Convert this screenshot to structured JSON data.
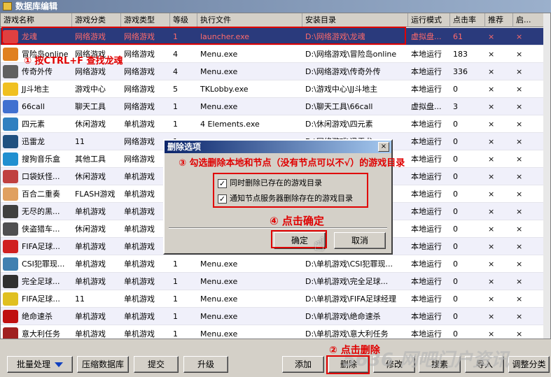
{
  "window": {
    "title": "数据库编辑"
  },
  "columns": [
    "游戏名称",
    "游戏分类",
    "游戏类型",
    "等级",
    "执行文件",
    "安装目录",
    "运行模式",
    "点击率",
    "推荐",
    "启..."
  ],
  "rows": [
    {
      "name": "龙魂",
      "category": "网络游戏",
      "type": "网络游戏",
      "level": "1",
      "exe": "launcher.exe",
      "dir": "D:\\网络游戏\\龙魂",
      "mode": "虚拟盘...",
      "clicks": "61",
      "rec": "×",
      "start": "×",
      "icon": "#e04040"
    },
    {
      "name": "冒险岛online",
      "category": "网络游戏",
      "type": "网络游戏",
      "level": "4",
      "exe": "Menu.exe",
      "dir": "D:\\网络游戏\\冒险岛online",
      "mode": "本地运行",
      "clicks": "183",
      "rec": "×",
      "start": "×",
      "icon": "#e08020"
    },
    {
      "name": "传奇外传",
      "category": "网络游戏",
      "type": "网络游戏",
      "level": "4",
      "exe": "Menu.exe",
      "dir": "D:\\网络游戏\\传奇外传",
      "mode": "本地运行",
      "clicks": "336",
      "rec": "×",
      "start": "×",
      "icon": "#606060"
    },
    {
      "name": "JJ斗地主",
      "category": "游戏中心",
      "type": "网络游戏",
      "level": "5",
      "exe": "TKLobby.exe",
      "dir": "D:\\游戏中心\\JJ斗地主",
      "mode": "本地运行",
      "clicks": "0",
      "rec": "×",
      "start": "×",
      "icon": "#f0c020"
    },
    {
      "name": "66call",
      "category": "聊天工具",
      "type": "网络游戏",
      "level": "1",
      "exe": "Menu.exe",
      "dir": "D:\\聊天工具\\66call",
      "mode": "虚拟盘...",
      "clicks": "3",
      "rec": "×",
      "start": "×",
      "icon": "#4070d0"
    },
    {
      "name": "四元素",
      "category": "休闲游戏",
      "type": "单机游戏",
      "level": "1",
      "exe": "4 Elements.exe",
      "dir": "D:\\休闲游戏\\四元素",
      "mode": "本地运行",
      "clicks": "0",
      "rec": "×",
      "start": "×",
      "icon": "#3080c0"
    },
    {
      "name": "迅雷龙",
      "category": "11",
      "type": "网络游戏",
      "level": "1",
      "exe": "",
      "dir": "D:\\网络游戏\\迅雷龙",
      "mode": "本地运行",
      "clicks": "0",
      "rec": "×",
      "start": "×",
      "icon": "#205080"
    },
    {
      "name": "搜狗音乐盒",
      "category": "其他工具",
      "type": "网络游戏",
      "level": "1",
      "exe": "",
      "dir": "",
      "mode": "本地运行",
      "clicks": "0",
      "rec": "×",
      "start": "×",
      "icon": "#2090d0"
    },
    {
      "name": "口袋妖怪...",
      "category": "休闲游戏",
      "type": "单机游戏",
      "level": "1",
      "exe": "",
      "dir": "",
      "mode": "本地运行",
      "clicks": "0",
      "rec": "×",
      "start": "×",
      "icon": "#c04040"
    },
    {
      "name": "百合二重奏",
      "category": "FLASH游戏",
      "type": "单机游戏",
      "level": "1",
      "exe": "",
      "dir": "",
      "mode": "本地运行",
      "clicks": "0",
      "rec": "×",
      "start": "×",
      "icon": "#e0a060"
    },
    {
      "name": "无尽的黑...",
      "category": "单机游戏",
      "type": "单机游戏",
      "level": "1",
      "exe": "",
      "dir": "",
      "mode": "本地运行",
      "clicks": "0",
      "rec": "×",
      "start": "×",
      "icon": "#404040"
    },
    {
      "name": "侠盗猎车...",
      "category": "休闲游戏",
      "type": "单机游戏",
      "level": "1",
      "exe": "",
      "dir": "",
      "mode": "本地运行",
      "clicks": "0",
      "rec": "×",
      "start": "×",
      "icon": "#505050"
    },
    {
      "name": "FIFA足球...",
      "category": "单机游戏",
      "type": "单机游戏",
      "level": "1",
      "exe": "",
      "dir": "",
      "mode": "本地运行",
      "clicks": "0",
      "rec": "×",
      "start": "×",
      "icon": "#d02020"
    },
    {
      "name": "CSI犯罪现...",
      "category": "单机游戏",
      "type": "单机游戏",
      "level": "1",
      "exe": "Menu.exe",
      "dir": "D:\\单机游戏\\CSI犯罪现...",
      "mode": "本地运行",
      "clicks": "0",
      "rec": "×",
      "start": "×",
      "icon": "#4080b0"
    },
    {
      "name": "完全足球...",
      "category": "单机游戏",
      "type": "单机游戏",
      "level": "1",
      "exe": "Menu.exe",
      "dir": "D:\\单机游戏\\完全足球...",
      "mode": "本地运行",
      "clicks": "0",
      "rec": "×",
      "start": "×",
      "icon": "#303030"
    },
    {
      "name": "FIFA足球...",
      "category": "11",
      "type": "单机游戏",
      "level": "1",
      "exe": "Menu.exe",
      "dir": "D:\\单机游戏\\FIFA足球经理",
      "mode": "本地运行",
      "clicks": "0",
      "rec": "×",
      "start": "×",
      "icon": "#e0c020"
    },
    {
      "name": "绝命速杀",
      "category": "单机游戏",
      "type": "单机游戏",
      "level": "1",
      "exe": "Menu.exe",
      "dir": "D:\\单机游戏\\绝命速杀",
      "mode": "本地运行",
      "clicks": "0",
      "rec": "×",
      "start": "×",
      "icon": "#c01010"
    },
    {
      "name": "意大利任务",
      "category": "单机游戏",
      "type": "单机游戏",
      "level": "1",
      "exe": "Menu.exe",
      "dir": "D:\\单机游戏\\意大利任务",
      "mode": "本地运行",
      "clicks": "0",
      "rec": "×",
      "start": "×",
      "icon": "#a02020"
    }
  ],
  "buttons": {
    "batch": "批量处理",
    "compress": "压缩数据库",
    "submit": "提交",
    "upgrade": "升级",
    "add": "添加",
    "delete": "删除",
    "modify": "修改",
    "search": "搜素",
    "import": "导入",
    "adjust": "调整分类"
  },
  "dialog": {
    "title": "删除选项",
    "close": "×",
    "option1": "同时删除已存在的游戏目录",
    "option2": "通知节点服务器删除存在的游戏目录",
    "ok": "确定",
    "cancel": "取消"
  },
  "annotations": {
    "step1": "① 按CTRL+F 查找龙魂",
    "step2": "② 点击删除",
    "step3": "③ 勾选删除本地和节点（没有节点可以不√）的游戏目录",
    "step4": "④ 点击确定"
  },
  "watermark": "5636 网吧门户资讯"
}
